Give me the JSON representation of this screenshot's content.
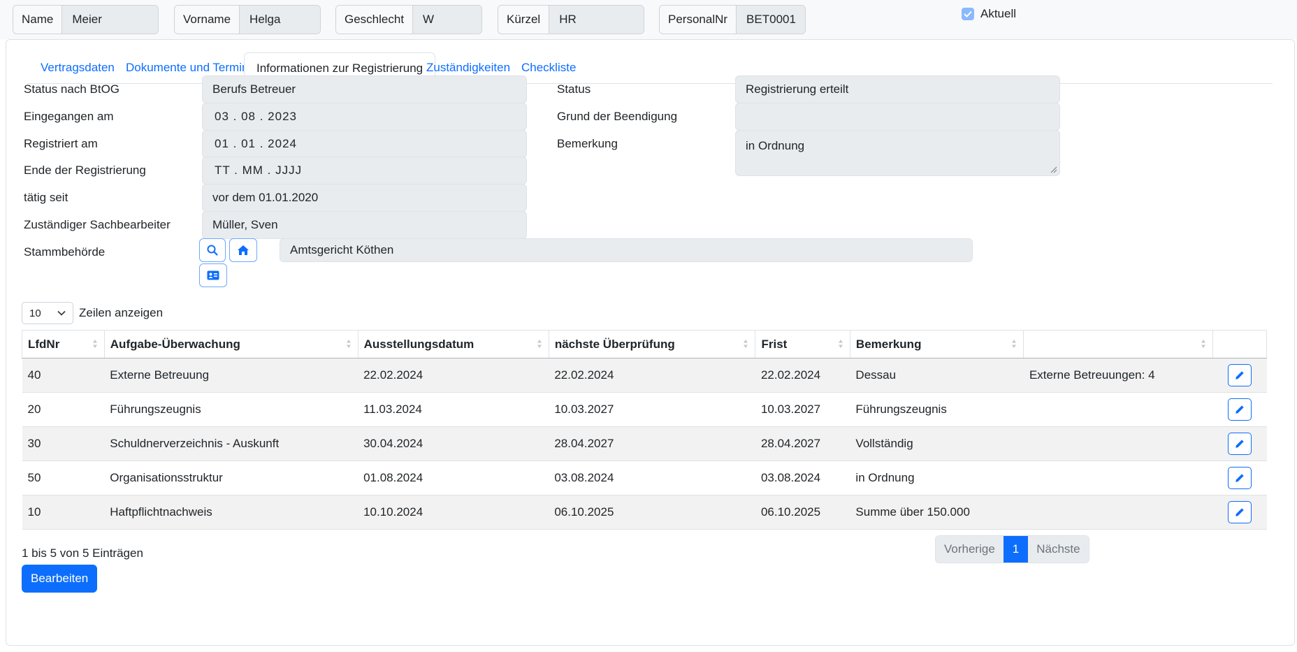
{
  "header": {
    "fields": [
      {
        "label": "Name",
        "value": "Meier"
      },
      {
        "label": "Vorname",
        "value": "Helga"
      },
      {
        "label": "Geschlecht",
        "value": "W"
      },
      {
        "label": "Kürzel",
        "value": "HR"
      },
      {
        "label": "PersonalNr",
        "value": "BET0001"
      }
    ],
    "aktuell_label": "Aktuell",
    "aktuell_checked": true
  },
  "tabs": [
    {
      "label": "Vertragsdaten",
      "active": false
    },
    {
      "label": "Dokumente und Termine",
      "active": false
    },
    {
      "label": "Informationen zur Registrierung",
      "active": true
    },
    {
      "label": "Zuständigkeiten",
      "active": false
    },
    {
      "label": "Checkliste",
      "active": false
    }
  ],
  "form": {
    "left": [
      {
        "label": "Status nach BtOG",
        "value": "Berufs Betreuer"
      },
      {
        "label": "Eingegangen am",
        "value": "03 . 08 . 2023"
      },
      {
        "label": "Registriert am",
        "value": "01 . 01 . 2024"
      },
      {
        "label": "Ende der Registrierung",
        "value": "TT . MM . JJJJ"
      },
      {
        "label": "tätig seit",
        "value": "vor dem 01.01.2020"
      },
      {
        "label": "Zuständiger Sachbearbeiter",
        "value": "Müller, Sven"
      }
    ],
    "right": [
      {
        "label": "Status",
        "value": "Registrierung erteilt"
      },
      {
        "label": "Grund der Beendigung",
        "value": ""
      },
      {
        "label": "Bemerkung",
        "value": "in Ordnung"
      }
    ],
    "stammbehoerde": {
      "label": "Stammbehörde",
      "value": "Amtsgericht Köthen"
    }
  },
  "table": {
    "length_value": "10",
    "length_suffix": "Zeilen anzeigen",
    "columns": [
      "LfdNr",
      "Aufgabe-Überwachung",
      "Ausstellungsdatum",
      "nächste Überprüfung",
      "Frist",
      "Bemerkung",
      "",
      ""
    ],
    "rows": [
      [
        "40",
        "Externe Betreuung",
        "22.02.2024",
        "22.02.2024",
        "22.02.2024",
        "Dessau",
        "Externe Betreuungen: 4"
      ],
      [
        "20",
        "Führungszeugnis",
        "11.03.2024",
        "10.03.2027",
        "10.03.2027",
        "Führungszeugnis",
        ""
      ],
      [
        "30",
        "Schuldnerverzeichnis - Auskunft",
        "30.04.2024",
        "28.04.2027",
        "28.04.2027",
        "Vollständig",
        ""
      ],
      [
        "50",
        "Organisationsstruktur",
        "01.08.2024",
        "03.08.2024",
        "03.08.2024",
        "in Ordnung",
        ""
      ],
      [
        "10",
        "Haftpflichtnachweis",
        "10.10.2024",
        "06.10.2025",
        "06.10.2025",
        "Summe über 150.000",
        ""
      ]
    ],
    "info": "1 bis 5 von 5 Einträgen",
    "pagination": {
      "prev": "Vorherige",
      "current": "1",
      "next": "Nächste"
    }
  },
  "actions": {
    "edit_label": "Bearbeiten"
  },
  "colors": {
    "primary": "#0d6efd",
    "field_bg": "#e9ecef",
    "stripe": "#f2f2f2"
  }
}
